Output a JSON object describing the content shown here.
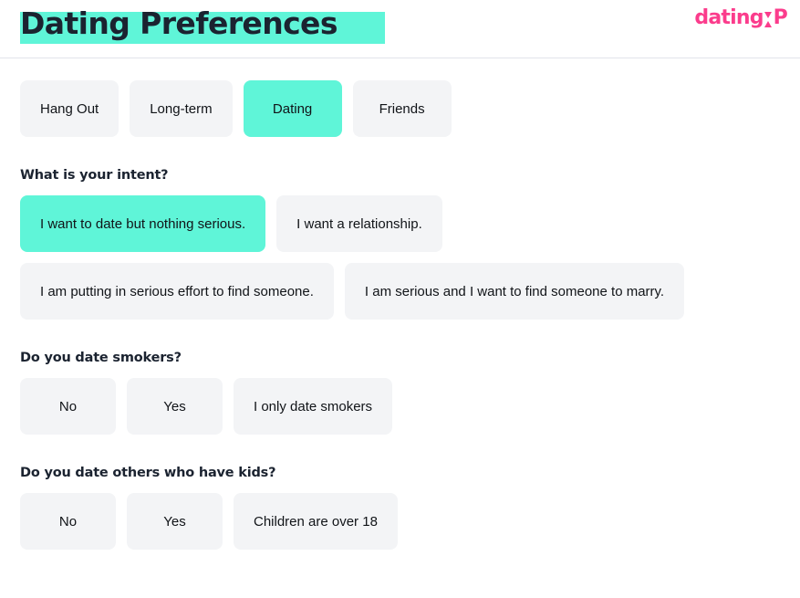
{
  "header": {
    "title": "Dating Preferences",
    "title_highlight_color": "#5FF5D8",
    "title_color": "#1B2330",
    "logo": {
      "word": "dating",
      "mark": "x-hourglass-icon",
      "suffix": "P",
      "color": "#FB3C8C"
    }
  },
  "tabs": [
    {
      "label": "Hang Out",
      "selected": false
    },
    {
      "label": "Long-term",
      "selected": false
    },
    {
      "label": "Dating",
      "selected": true
    },
    {
      "label": "Friends",
      "selected": false
    }
  ],
  "sections": [
    {
      "heading": "What is your intent?",
      "rows": [
        [
          {
            "label": "I want to date but nothing serious.",
            "selected": true
          },
          {
            "label": "I want a relationship.",
            "selected": false
          }
        ],
        [
          {
            "label": "I am putting in serious effort to find someone.",
            "selected": false
          },
          {
            "label": "I am serious and I want to find someone to marry.",
            "selected": false
          }
        ]
      ]
    },
    {
      "heading": "Do you date smokers?",
      "rows": [
        [
          {
            "label": "No",
            "selected": false,
            "pill": true
          },
          {
            "label": "Yes",
            "selected": false,
            "pill": true
          },
          {
            "label": "I only date smokers",
            "selected": false
          }
        ]
      ]
    },
    {
      "heading": "Do you date others who have kids?",
      "rows": [
        [
          {
            "label": "No",
            "selected": false,
            "pill": true
          },
          {
            "label": "Yes",
            "selected": false,
            "pill": true
          },
          {
            "label": "Children are over 18",
            "selected": false
          }
        ]
      ]
    }
  ],
  "theme": {
    "accent": "#5FF5D8",
    "brand_pink": "#FB3C8C",
    "surface": "#F3F4F6",
    "divider": "#E1E4EA",
    "text": "#111418"
  }
}
